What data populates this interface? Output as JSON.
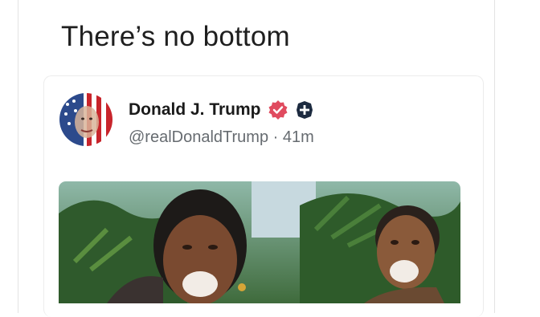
{
  "post": {
    "text": "There’s no bottom"
  },
  "quoted_post": {
    "display_name": "Donald J. Trump",
    "handle": "@realDonaldTrump",
    "separator": "·",
    "time_ago": "41m",
    "badges": [
      "verified-badge-icon",
      "plus-badge-icon"
    ]
  },
  "colors": {
    "verified_badge": "#e04b5f",
    "plus_badge": "#1c2a3f",
    "handle_text": "#666b70"
  }
}
